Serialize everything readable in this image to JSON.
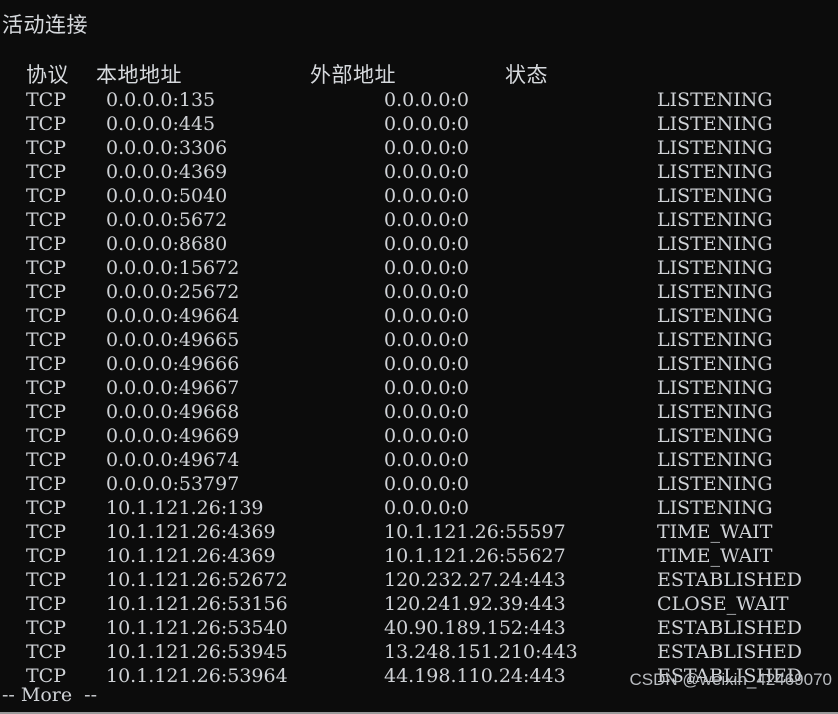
{
  "window": {
    "title_line": "活动连接",
    "background_color": "#0c0c0c",
    "text_color": "#cfd2d6"
  },
  "table": {
    "headers": {
      "protocol": "协议",
      "local_address": "本地地址",
      "foreign_address": "外部地址",
      "state": "状态"
    },
    "rows": [
      {
        "protocol": "TCP",
        "local": "0.0.0.0:135",
        "foreign": "0.0.0.0:0",
        "state": "LISTENING"
      },
      {
        "protocol": "TCP",
        "local": "0.0.0.0:445",
        "foreign": "0.0.0.0:0",
        "state": "LISTENING"
      },
      {
        "protocol": "TCP",
        "local": "0.0.0.0:3306",
        "foreign": "0.0.0.0:0",
        "state": "LISTENING"
      },
      {
        "protocol": "TCP",
        "local": "0.0.0.0:4369",
        "foreign": "0.0.0.0:0",
        "state": "LISTENING"
      },
      {
        "protocol": "TCP",
        "local": "0.0.0.0:5040",
        "foreign": "0.0.0.0:0",
        "state": "LISTENING"
      },
      {
        "protocol": "TCP",
        "local": "0.0.0.0:5672",
        "foreign": "0.0.0.0:0",
        "state": "LISTENING"
      },
      {
        "protocol": "TCP",
        "local": "0.0.0.0:8680",
        "foreign": "0.0.0.0:0",
        "state": "LISTENING"
      },
      {
        "protocol": "TCP",
        "local": "0.0.0.0:15672",
        "foreign": "0.0.0.0:0",
        "state": "LISTENING"
      },
      {
        "protocol": "TCP",
        "local": "0.0.0.0:25672",
        "foreign": "0.0.0.0:0",
        "state": "LISTENING"
      },
      {
        "protocol": "TCP",
        "local": "0.0.0.0:49664",
        "foreign": "0.0.0.0:0",
        "state": "LISTENING"
      },
      {
        "protocol": "TCP",
        "local": "0.0.0.0:49665",
        "foreign": "0.0.0.0:0",
        "state": "LISTENING"
      },
      {
        "protocol": "TCP",
        "local": "0.0.0.0:49666",
        "foreign": "0.0.0.0:0",
        "state": "LISTENING"
      },
      {
        "protocol": "TCP",
        "local": "0.0.0.0:49667",
        "foreign": "0.0.0.0:0",
        "state": "LISTENING"
      },
      {
        "protocol": "TCP",
        "local": "0.0.0.0:49668",
        "foreign": "0.0.0.0:0",
        "state": "LISTENING"
      },
      {
        "protocol": "TCP",
        "local": "0.0.0.0:49669",
        "foreign": "0.0.0.0:0",
        "state": "LISTENING"
      },
      {
        "protocol": "TCP",
        "local": "0.0.0.0:49674",
        "foreign": "0.0.0.0:0",
        "state": "LISTENING"
      },
      {
        "protocol": "TCP",
        "local": "0.0.0.0:53797",
        "foreign": "0.0.0.0:0",
        "state": "LISTENING"
      },
      {
        "protocol": "TCP",
        "local": "10.1.121.26:139",
        "foreign": "0.0.0.0:0",
        "state": "LISTENING"
      },
      {
        "protocol": "TCP",
        "local": "10.1.121.26:4369",
        "foreign": "10.1.121.26:55597",
        "state": "TIME_WAIT"
      },
      {
        "protocol": "TCP",
        "local": "10.1.121.26:4369",
        "foreign": "10.1.121.26:55627",
        "state": "TIME_WAIT"
      },
      {
        "protocol": "TCP",
        "local": "10.1.121.26:52672",
        "foreign": "120.232.27.24:443",
        "state": "ESTABLISHED"
      },
      {
        "protocol": "TCP",
        "local": "10.1.121.26:53156",
        "foreign": "120.241.92.39:443",
        "state": "CLOSE_WAIT"
      },
      {
        "protocol": "TCP",
        "local": "10.1.121.26:53540",
        "foreign": "40.90.189.152:443",
        "state": "ESTABLISHED"
      },
      {
        "protocol": "TCP",
        "local": "10.1.121.26:53945",
        "foreign": "13.248.151.210:443",
        "state": "ESTABLISHED"
      },
      {
        "protocol": "TCP",
        "local": "10.1.121.26:53964",
        "foreign": "44.198.110.24:443",
        "state": "ESTABLISHED"
      }
    ]
  },
  "status": {
    "more_prompt": "-- More  --"
  },
  "watermark": {
    "text": "CSDN @weixin_42469070"
  }
}
